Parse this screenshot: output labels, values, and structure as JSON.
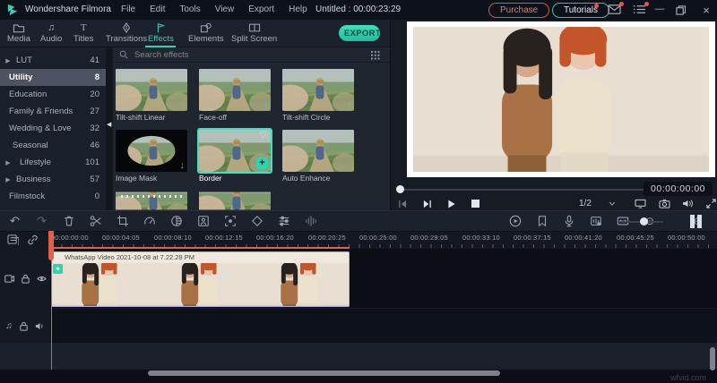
{
  "titlebar": {
    "app_name": "Wondershare Filmora",
    "menus": [
      "File",
      "Edit",
      "Tools",
      "View",
      "Export",
      "Help"
    ],
    "project_title": "Untitled : 00:00:23:29",
    "purchase_label": "Purchase",
    "tutorials_label": "Tutorials"
  },
  "tabs": {
    "media": "Media",
    "audio": "Audio",
    "titles": "Titles",
    "transitions": "Transitions",
    "effects": "Effects",
    "elements": "Elements",
    "split_screen": "Split Screen",
    "export_label": "EXPORT"
  },
  "sidebar": {
    "items": [
      {
        "label": "LUT",
        "count": "41"
      },
      {
        "label": "Utility",
        "count": "8"
      },
      {
        "label": "Education",
        "count": "20"
      },
      {
        "label": "Family & Friends",
        "count": "27"
      },
      {
        "label": "Wedding & Love",
        "count": "32"
      },
      {
        "label": "Seasonal",
        "count": "46"
      },
      {
        "label": "Lifestyle",
        "count": "101"
      },
      {
        "label": "Business",
        "count": "57"
      },
      {
        "label": "Filmstock",
        "count": "0"
      }
    ]
  },
  "effects_panel": {
    "search_placeholder": "Search effects",
    "cards": [
      {
        "name": "Tilt-shift Linear"
      },
      {
        "name": "Face-off"
      },
      {
        "name": "Tilt-shift Circle"
      },
      {
        "name": "Image Mask"
      },
      {
        "name": "Border",
        "selected": true
      },
      {
        "name": "Auto Enhance"
      }
    ]
  },
  "preview": {
    "timecode": "00:00:00:00",
    "zoom_level": "1/2",
    "open_bracket": "{",
    "close_bracket": "}"
  },
  "timeline": {
    "ruler_ticks": [
      "00:00:00:00",
      "00:00:04:05",
      "00:00:08:10",
      "00:00:12:15",
      "00:00:16:20",
      "00:00:20:25",
      "00:00:25:00",
      "00:00:29:05",
      "00:00:33:10",
      "00:00:37:15",
      "00:00:41:20",
      "00:00:45:25",
      "00:00:50:00"
    ],
    "clip_label": "WhatsApp Video 2021-10-08 at 7.22.28 PM"
  },
  "watermark": "wfvid.com",
  "colors": {
    "accent_teal": "#2ed3b2",
    "purchase_red": "#e0655c",
    "playhead_red": "#e0604e",
    "clip_border_purple": "#b5abe4",
    "selected_sidebar": "#4c5362"
  }
}
